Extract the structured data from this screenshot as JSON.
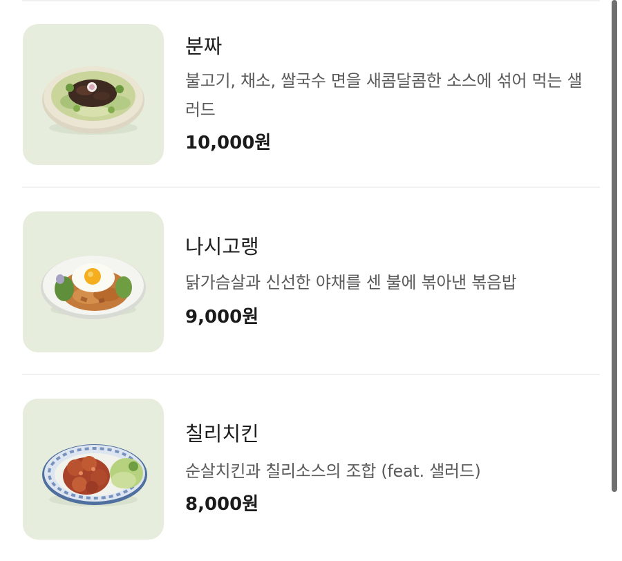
{
  "menu": {
    "items": [
      {
        "name": "분짜",
        "description": "불고기, 채소, 쌀국수 면을 새콤달콤한 소스에 섞어 먹는 샐러드",
        "price": "10,000원",
        "image_icon": "bun-cha-salad-bowl-icon"
      },
      {
        "name": "나시고랭",
        "description": "닭가슴살과 신선한 야채를 센 불에 볶아낸 볶음밥",
        "price": "9,000원",
        "image_icon": "nasi-goreng-plate-icon"
      },
      {
        "name": "칠리치킨",
        "description": "순살치킨과 칠리소스의 조합 (feat. 샐러드)",
        "price": "8,000원",
        "image_icon": "chili-chicken-plate-icon"
      }
    ]
  },
  "colors": {
    "thumbnail_background": "#e6eddc",
    "divider": "#f1f1f1",
    "scrollbar": "#6f6f6f"
  }
}
